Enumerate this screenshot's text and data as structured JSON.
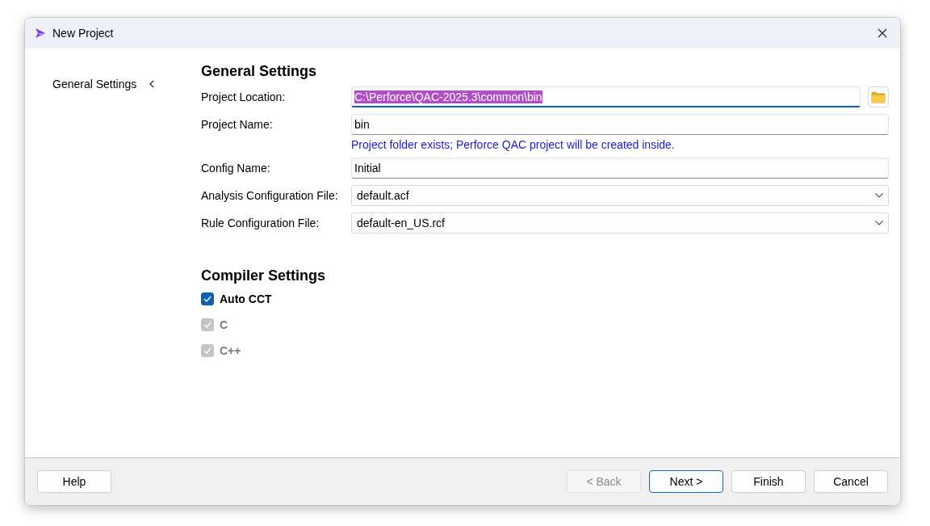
{
  "window": {
    "title": "New Project"
  },
  "sidebar": {
    "items": [
      {
        "label": "General Settings"
      }
    ]
  },
  "general_settings": {
    "heading": "General Settings",
    "fields": [
      {
        "kind": "path",
        "label": "Project Location:",
        "value": "C:\\Perforce\\QAC-2025.3\\common\\bin",
        "focused": true
      },
      {
        "kind": "text",
        "label": "Project Name:",
        "value": "bin",
        "focused": false,
        "note": "Project folder exists; Perforce QAC project will be created inside."
      },
      {
        "kind": "text",
        "label": "Config Name:",
        "value": "Initial",
        "focused": false
      },
      {
        "kind": "dropdown",
        "label": "Analysis Configuration File:",
        "value": "default.acf",
        "focused": false
      },
      {
        "kind": "dropdown",
        "label": "Rule Configuration File:",
        "value": "default-en_US.rcf",
        "focused": false
      }
    ]
  },
  "compiler_settings": {
    "heading": "Compiler Settings",
    "options": [
      {
        "label": "Auto CCT",
        "checked": true,
        "disabled": false
      },
      {
        "label": "C",
        "checked": true,
        "disabled": true
      },
      {
        "label": "C++",
        "checked": true,
        "disabled": true
      }
    ]
  },
  "help_button": {
    "label": "Help"
  },
  "buttons": [
    {
      "label": "< Back",
      "disabled": true,
      "default": false
    },
    {
      "label": "Next >",
      "disabled": false,
      "default": true
    },
    {
      "label": "Finish",
      "disabled": false,
      "default": false
    },
    {
      "label": "Cancel",
      "disabled": false,
      "default": false
    }
  ]
}
